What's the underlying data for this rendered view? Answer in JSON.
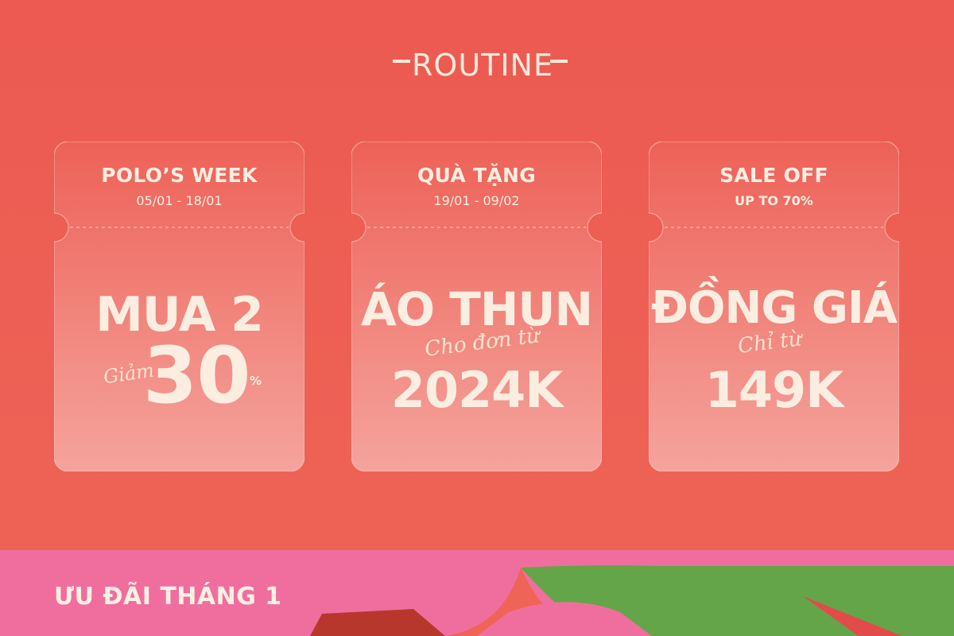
{
  "brand": {
    "name": "ROUTINE"
  },
  "tickets": [
    {
      "title": "POLO’S WEEK",
      "subtitle": "05/01 - 18/01",
      "headline": "MUA 2",
      "script": "Giảm",
      "value": "30",
      "unit": "%"
    },
    {
      "title": "QUÀ TẶNG",
      "subtitle": "19/01 - 09/02",
      "headline": "ÁO THUN",
      "script": "Cho đơn từ",
      "value": "2024K"
    },
    {
      "title": "SALE OFF",
      "subtitle": "UP TO 70%",
      "headline": "ĐỒNG GIÁ",
      "script": "Chỉ từ",
      "value": "149K"
    }
  ],
  "banner": {
    "label": "ƯU ĐÃI THÁNG 1"
  },
  "colors": {
    "background": "#ec5e54",
    "cream": "#fbeee0",
    "pink": "#ef6c9a",
    "green": "#63a548"
  }
}
